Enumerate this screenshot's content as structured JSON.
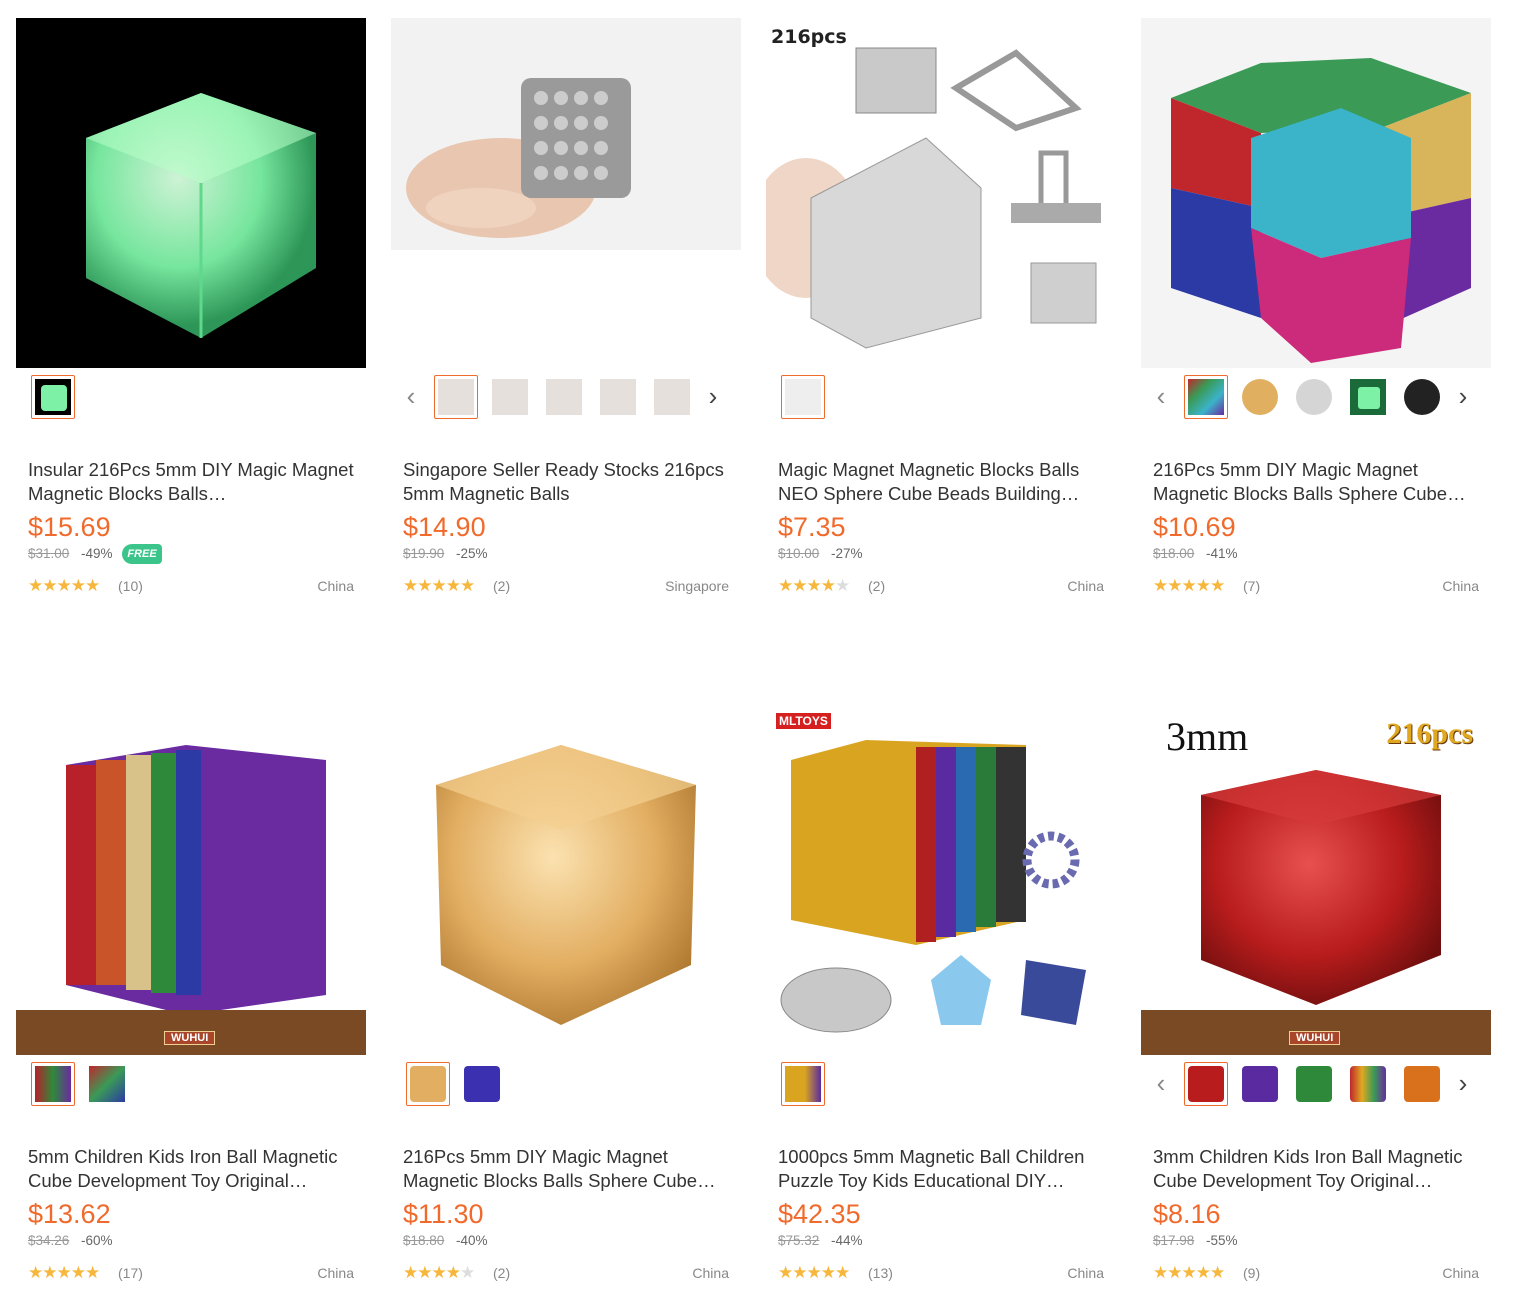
{
  "products": [
    {
      "title": "Insular 216Pcs 5mm DIY Magic Magnet Magnetic Blocks Balls…",
      "price": "$15.69",
      "original_price": "$31.00",
      "discount": "-49%",
      "free_badge": "FREE",
      "rating": 4.5,
      "reviews": "(10)",
      "origin": "China",
      "image_color": "glow-green",
      "thumbnails": 1
    },
    {
      "title": "Singapore Seller Ready Stocks 216pcs 5mm Magnetic Balls",
      "price": "$14.90",
      "original_price": "$19.90",
      "discount": "-25%",
      "rating": 5,
      "reviews": "(2)",
      "origin": "Singapore",
      "image_color": "silver",
      "thumbnails": 5
    },
    {
      "title": "Magic Magnet Magnetic Blocks Balls NEO Sphere Cube Beads Building…",
      "price": "$7.35",
      "original_price": "$10.00",
      "discount": "-27%",
      "rating": 4,
      "reviews": "(2)",
      "origin": "China",
      "image_label": "216pcs",
      "image_color": "silver-cubes",
      "thumbnails": 1
    },
    {
      "title": "216Pcs 5mm DIY Magic Magnet Magnetic Blocks Balls Sphere Cube…",
      "price": "$10.69",
      "original_price": "$18.00",
      "discount": "-41%",
      "rating": 4.5,
      "reviews": "(7)",
      "origin": "China",
      "image_color": "multicolor",
      "thumbnails": 5
    },
    {
      "title": "5mm Children Kids Iron Ball Magnetic Cube Development Toy Original…",
      "price": "$13.62",
      "original_price": "$34.26",
      "discount": "-60%",
      "rating": 5,
      "reviews": "(17)",
      "origin": "China",
      "image_brand": "WUHUI",
      "image_color": "rainbow-purple",
      "thumbnails": 2
    },
    {
      "title": "216Pcs 5mm DIY Magic Magnet Magnetic Blocks Balls Sphere Cube…",
      "price": "$11.30",
      "original_price": "$18.80",
      "discount": "-40%",
      "rating": 4,
      "reviews": "(2)",
      "origin": "China",
      "image_color": "gold",
      "thumbnails": 2
    },
    {
      "title": "1000pcs 5mm Magnetic Ball Children Puzzle Toy Kids Educational DIY…",
      "price": "$42.35",
      "original_price": "$75.32",
      "discount": "-44%",
      "rating": 4.5,
      "reviews": "(13)",
      "origin": "China",
      "image_brand": "MLTOYS",
      "image_color": "gold-rainbow",
      "thumbnails": 1
    },
    {
      "title": "3mm Children Kids Iron Ball Magnetic Cube Development Toy Original…",
      "price": "$8.16",
      "original_price": "$17.98",
      "discount": "-55%",
      "rating": 5,
      "reviews": "(9)",
      "origin": "China",
      "image_label": "3mm",
      "image_label2": "216pcs",
      "image_brand": "WUHUI",
      "image_color": "red",
      "thumbnails": 5
    }
  ],
  "colors": {
    "price": "#f06a2c",
    "star": "#f6b73c",
    "free_badge": "#3cc58a"
  }
}
